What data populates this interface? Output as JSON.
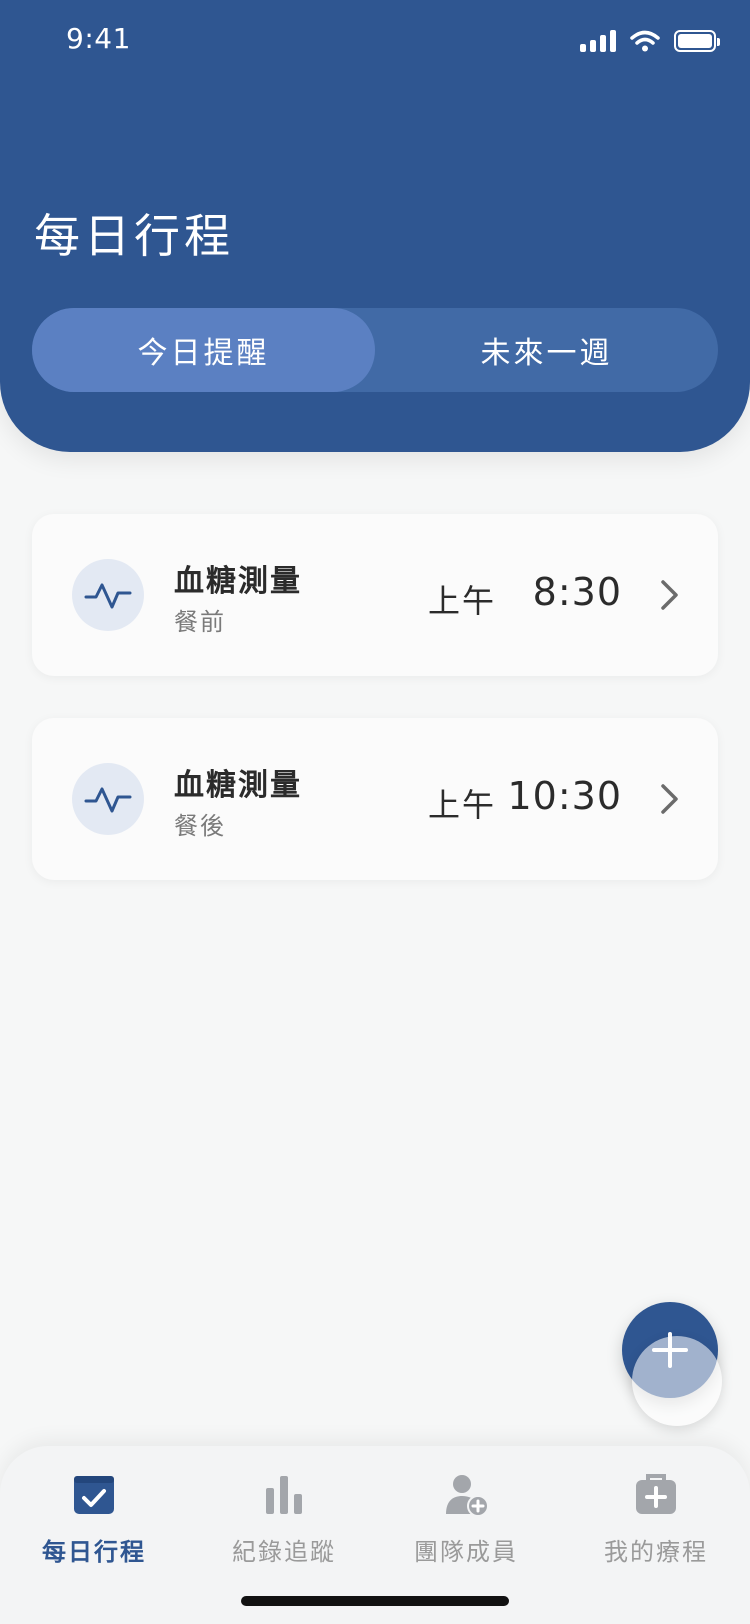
{
  "status_bar": {
    "time": "9:41"
  },
  "header": {
    "title": "每日行程",
    "tabs": [
      {
        "label": "今日提醒",
        "active": true
      },
      {
        "label": "未來一週",
        "active": false
      }
    ]
  },
  "reminders": [
    {
      "title": "血糖測量",
      "subtitle": "餐前",
      "period": "上午",
      "time": "8:30",
      "icon": "pulse-icon"
    },
    {
      "title": "血糖測量",
      "subtitle": "餐後",
      "period": "上午",
      "time": "10:30",
      "icon": "pulse-icon"
    }
  ],
  "fab": {
    "icon": "plus-icon"
  },
  "bottom_nav": {
    "items": [
      {
        "label": "每日行程",
        "icon": "calendar-check-icon",
        "active": true
      },
      {
        "label": "紀錄追蹤",
        "icon": "bar-chart-icon",
        "active": false
      },
      {
        "label": "團隊成員",
        "icon": "add-user-icon",
        "active": false
      },
      {
        "label": "我的療程",
        "icon": "medical-kit-icon",
        "active": false
      }
    ]
  },
  "colors": {
    "primary": "#2f5691",
    "segment_bg": "#416aa6",
    "segment_active": "#5b80c2",
    "icon_bg": "#e3e9f3",
    "inactive": "#9a9a9a"
  }
}
